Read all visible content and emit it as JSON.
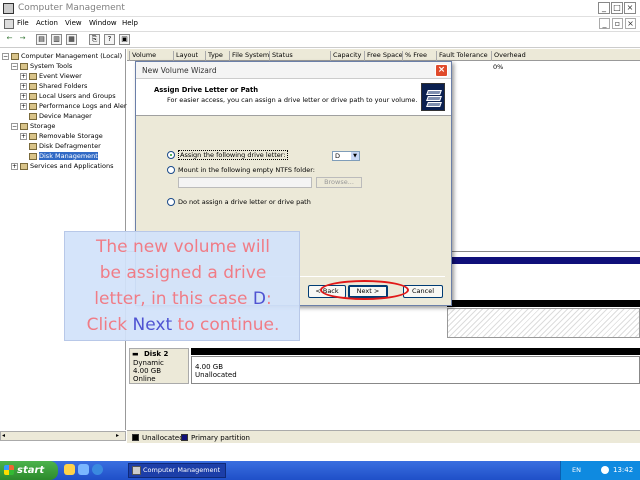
{
  "window": {
    "title": "Computer Management"
  },
  "menu": [
    "File",
    "Action",
    "View",
    "Window",
    "Help"
  ],
  "tree": [
    {
      "label": "Computer Management (Local)",
      "level": 0,
      "expander": "−"
    },
    {
      "label": "System Tools",
      "level": 1,
      "expander": "−"
    },
    {
      "label": "Event Viewer",
      "level": 2,
      "expander": "+"
    },
    {
      "label": "Shared Folders",
      "level": 2,
      "expander": "+"
    },
    {
      "label": "Local Users and Groups",
      "level": 2,
      "expander": "+"
    },
    {
      "label": "Performance Logs and Alerts",
      "level": 2,
      "expander": "+"
    },
    {
      "label": "Device Manager",
      "level": 2,
      "expander": ""
    },
    {
      "label": "Storage",
      "level": 1,
      "expander": "−"
    },
    {
      "label": "Removable Storage",
      "level": 2,
      "expander": "+"
    },
    {
      "label": "Disk Defragmenter",
      "level": 2,
      "expander": ""
    },
    {
      "label": "Disk Management",
      "level": 2,
      "expander": "",
      "selected": true
    },
    {
      "label": "Services and Applications",
      "level": 1,
      "expander": "+"
    }
  ],
  "columns": [
    "Volume",
    "Layout",
    "Type",
    "File System",
    "Status",
    "Capacity",
    "Free Space",
    "% Free",
    "Fault Tolerance",
    "Overhead"
  ],
  "grid_first_row": {
    "overhead": "0%"
  },
  "disk2": {
    "name": "Disk 2",
    "type": "Dynamic",
    "size": "4.00 GB",
    "status": "Online",
    "part_size": "4.00 GB",
    "part_state": "Unallocated"
  },
  "legend": [
    "Unallocated",
    "Primary partition"
  ],
  "dialog": {
    "title": "New Volume Wizard",
    "heading": "Assign Drive Letter or Path",
    "subheading": "For easier access, you can assign a drive letter or drive path to your volume.",
    "option_assign": "Assign the following drive letter:",
    "drive_letter": "D",
    "option_mount": "Mount in the following empty NTFS folder:",
    "browse": "Browse...",
    "option_none": "Do not assign a drive letter or drive path",
    "back": "< Back",
    "next": "Next >",
    "cancel": "Cancel"
  },
  "annotation": {
    "line1": "The new volume will",
    "line2": "be assigned a drive",
    "line3_pre": "letter, in this case ",
    "line3_hi": "D",
    "line3_post": ":",
    "line4_pre": "Click ",
    "line4_hi": "Next",
    "line4_post": " to continue."
  },
  "taskbar": {
    "start": "start",
    "task": "Computer Management",
    "lang": "EN",
    "clock": "13:42"
  },
  "colors": {
    "accent_red": "#e01818",
    "annotation_pink": "#f07c86",
    "annotation_blue": "#4f53d2",
    "volume_bar": "#10107a"
  }
}
